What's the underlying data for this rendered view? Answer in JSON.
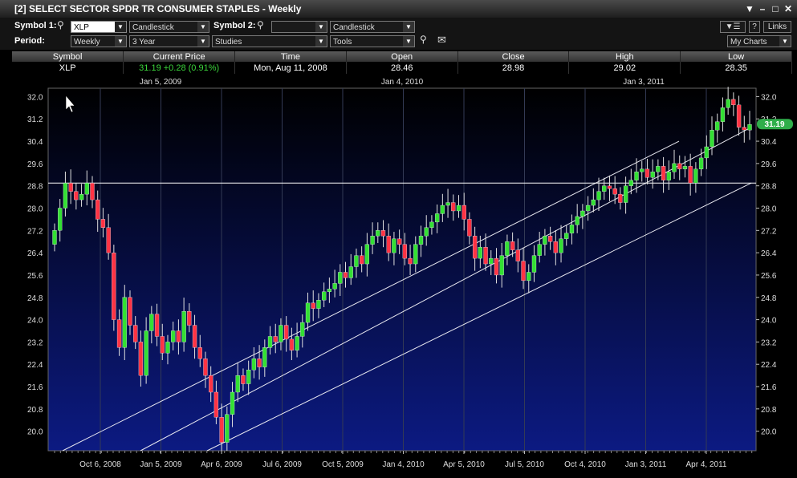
{
  "window": {
    "title": "[2] SELECT SECTOR SPDR TR CONSUMER STAPLES - Weekly",
    "buttons": [
      "▼",
      "–",
      "□",
      "✕"
    ]
  },
  "toolbar": {
    "symbol1_label": "Symbol 1:",
    "symbol1_value": "XLP",
    "chart_type1": "Candlestick",
    "symbol2_label": "Symbol 2:",
    "symbol2_value": "",
    "chart_type2": "Candlestick",
    "period_label": "Period:",
    "period_value": "Weekly",
    "range_value": "3 Year",
    "studies_value": "Studies",
    "tools_value": "Tools",
    "help_label": "?",
    "links_label": "Links",
    "my_charts_label": "My Charts"
  },
  "quote": {
    "headers": [
      "Symbol",
      "Current Price",
      "Time",
      "Open",
      "Close",
      "High",
      "Low"
    ],
    "values": [
      "XLP",
      "31.19 +0.28 (0.91%)",
      "Mon, Aug 11, 2008",
      "28.46",
      "28.98",
      "29.02",
      "28.35"
    ]
  },
  "colors": {
    "up": "#33e033",
    "down": "#ff3344",
    "price_tag": "#2fae4a"
  },
  "chart_data": {
    "type": "candlestick",
    "current_price_label": "31.19",
    "y_ticks": [
      32.0,
      31.2,
      30.4,
      29.6,
      28.8,
      28.0,
      27.2,
      26.4,
      25.6,
      24.8,
      24.0,
      23.2,
      22.4,
      21.6,
      20.8,
      20.0
    ],
    "ylim": [
      19.3,
      32.3
    ],
    "top_dates": [
      "Jan 5, 2009",
      "Jan 4, 2010",
      "Jan 3, 2011"
    ],
    "bottom_dates": [
      "Oct 6, 2008",
      "Jan 5, 2009",
      "Apr 6, 2009",
      "Jul 6, 2009",
      "Oct 5, 2009",
      "Jan 4, 2010",
      "Apr 5, 2010",
      "Jul 5, 2010",
      "Oct 4, 2010",
      "Jan 3, 2011",
      "Apr 4, 2011"
    ],
    "horizontal_line": 28.9,
    "closes": [
      27.2,
      28.0,
      28.9,
      28.6,
      28.3,
      28.5,
      28.9,
      28.3,
      27.6,
      27.3,
      26.4,
      24.0,
      23.0,
      24.8,
      23.8,
      23.2,
      22.0,
      23.6,
      24.2,
      23.4,
      22.8,
      23.2,
      23.6,
      23.2,
      24.3,
      23.8,
      23.0,
      22.6,
      22.0,
      21.4,
      20.5,
      19.6,
      20.6,
      21.4,
      22.0,
      21.7,
      22.2,
      22.6,
      22.3,
      23.0,
      23.4,
      23.2,
      23.8,
      23.3,
      22.9,
      23.4,
      23.9,
      24.6,
      24.4,
      24.7,
      25.0,
      25.1,
      25.3,
      25.7,
      25.5,
      25.9,
      26.3,
      26.0,
      26.7,
      27.0,
      27.2,
      27.0,
      26.4,
      26.9,
      26.7,
      26.2,
      26.0,
      26.7,
      27.0,
      27.3,
      27.5,
      27.8,
      28.1,
      28.2,
      27.9,
      28.1,
      27.6,
      27.0,
      26.2,
      26.6,
      26.0,
      26.2,
      25.6,
      26.3,
      26.8,
      26.5,
      26.1,
      25.4,
      25.7,
      26.3,
      26.7,
      27.0,
      26.8,
      26.4,
      26.9,
      27.1,
      27.4,
      27.7,
      27.9,
      28.1,
      28.3,
      28.6,
      28.8,
      28.7,
      28.5,
      28.2,
      28.8,
      29.0,
      29.3,
      29.4,
      29.1,
      29.3,
      29.5,
      29.0,
      29.3,
      29.6,
      29.4,
      29.5,
      28.9,
      29.4,
      29.8,
      30.2,
      30.8,
      31.1,
      31.6,
      31.9,
      31.7,
      30.9,
      30.8,
      31.0
    ]
  }
}
